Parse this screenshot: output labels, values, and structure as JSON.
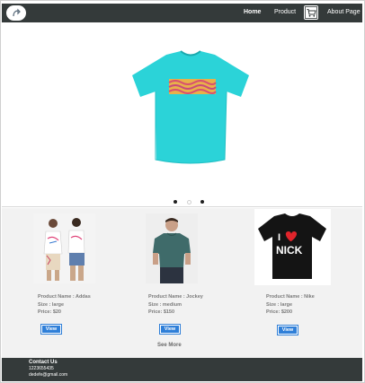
{
  "nav": {
    "logo": "logo-icon",
    "home_label": "Home",
    "product_label": "Product",
    "cart_icon": "cart-icon",
    "about_label": "About Page"
  },
  "hero": {
    "image": "cyan-tshirt-image",
    "active_slide": 1,
    "slide_count": 3
  },
  "products": [
    {
      "image": "two-models-white-shirts-image",
      "name": "Product Name : Addas",
      "size": "Size : large",
      "price": "Price: $20",
      "button": "View"
    },
    {
      "image": "man-green-tshirt-image",
      "name": "Product Name : Jockey",
      "size": "Size : medium",
      "price": "Price: $150",
      "button": "View"
    },
    {
      "image": "black-i-love-nick-tshirt-image",
      "name": "Product Name : Nike",
      "size": "Size : large",
      "price": "Price: $200",
      "button": "View"
    }
  ],
  "see_more_label": "See More",
  "footer": {
    "title": "Contact Us",
    "phone": "1223655435",
    "email": "dedefe@gmail.com"
  },
  "colors": {
    "navbar": "#343a3a",
    "accent": "#2f7fd8",
    "hero_shirt": "#2bd3d8"
  }
}
